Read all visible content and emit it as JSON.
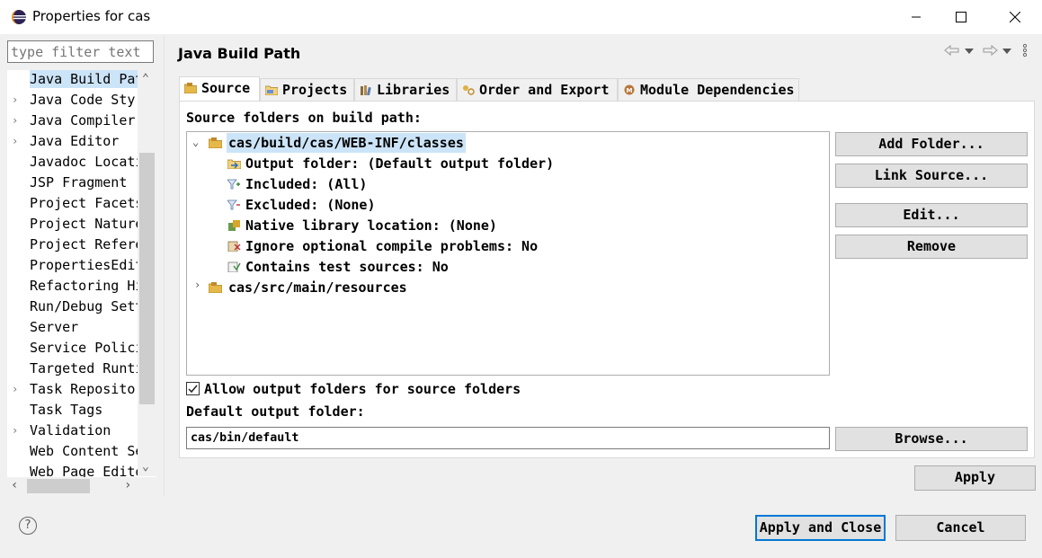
{
  "window": {
    "title": "Properties for cas"
  },
  "filter": {
    "placeholder": "type filter text"
  },
  "nav": {
    "items": [
      {
        "label": "Java Build Pat",
        "expandable": false,
        "selected": true
      },
      {
        "label": "Java Code Sty:",
        "expandable": true
      },
      {
        "label": "Java Compiler",
        "expandable": true
      },
      {
        "label": "Java Editor",
        "expandable": true
      },
      {
        "label": "Javadoc Locati",
        "expandable": false
      },
      {
        "label": "JSP Fragment",
        "expandable": false
      },
      {
        "label": "Project Facets",
        "expandable": false
      },
      {
        "label": "Project Nature",
        "expandable": false
      },
      {
        "label": "Project Refere",
        "expandable": false
      },
      {
        "label": "PropertiesEdit",
        "expandable": false
      },
      {
        "label": "Refactoring Hi",
        "expandable": false
      },
      {
        "label": "Run/Debug Sett",
        "expandable": false
      },
      {
        "label": "Server",
        "expandable": false
      },
      {
        "label": "Service Polici",
        "expandable": false
      },
      {
        "label": "Targeted Runti",
        "expandable": false
      },
      {
        "label": "Task Repositor",
        "expandable": true
      },
      {
        "label": "Task Tags",
        "expandable": false
      },
      {
        "label": "Validation",
        "expandable": true
      },
      {
        "label": "Web Content Se",
        "expandable": false
      },
      {
        "label": "Web Page Edito",
        "expandable": false
      }
    ]
  },
  "page": {
    "title": "Java Build Path"
  },
  "tabs": [
    {
      "label": "Source",
      "active": true
    },
    {
      "label": "Projects"
    },
    {
      "label": "Libraries"
    },
    {
      "label": "Order and Export"
    },
    {
      "label": "Module Dependencies"
    }
  ],
  "source": {
    "heading": "Source folders on build path:",
    "tree": {
      "root1": "cas/build/cas/WEB-INF/classes",
      "children": [
        "Output folder: (Default output folder)",
        "Included: (All)",
        "Excluded: (None)",
        "Native library location: (None)",
        "Ignore optional compile problems: No",
        "Contains test sources: No"
      ],
      "root2": "cas/src/main/resources"
    },
    "buttons": {
      "add_folder": "Add Folder...",
      "link_source": "Link Source...",
      "edit": "Edit...",
      "remove": "Remove",
      "browse": "Browse..."
    },
    "allow_output_label": "Allow output folders for source folders",
    "allow_output_checked": true,
    "default_output_label": "Default output folder:",
    "default_output_value": "cas/bin/default"
  },
  "actions": {
    "apply": "Apply",
    "apply_close": "Apply and Close",
    "cancel": "Cancel",
    "help": "?"
  },
  "colors": {
    "selection": "#cce4f7",
    "default_button_border": "#0078d7",
    "folder": "#d9a52a"
  }
}
